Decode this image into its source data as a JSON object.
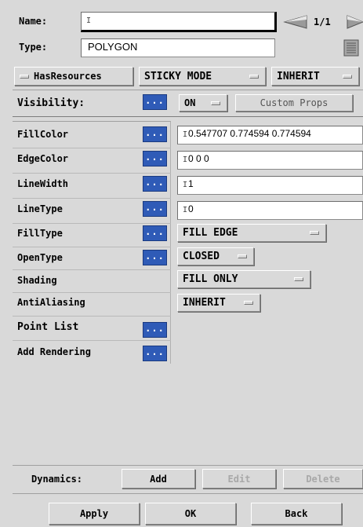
{
  "header": {
    "name_label": "Name:",
    "name_value": "",
    "page_indicator": "1/1",
    "type_label": "Type:",
    "type_value": "POLYGON"
  },
  "options": {
    "has_resources": "HasResources",
    "sticky_mode": "STICKY MODE",
    "inherit": "INHERIT"
  },
  "visibility": {
    "label": "Visibility:",
    "more": "...",
    "value": "ON",
    "custom_props": "Custom Props"
  },
  "properties": [
    {
      "label": "FillColor",
      "more": "...",
      "value": "0.547707 0.774594 0.774594"
    },
    {
      "label": "EdgeColor",
      "more": "...",
      "value": "0 0 0"
    },
    {
      "label": "LineWidth",
      "more": "...",
      "value": "1"
    },
    {
      "label": "LineType",
      "more": "...",
      "value": "0"
    },
    {
      "label": "FillType",
      "more": "...",
      "value": "FILL EDGE"
    },
    {
      "label": "OpenType",
      "more": "...",
      "value": "CLOSED"
    },
    {
      "label": "Shading",
      "value": "FILL ONLY"
    },
    {
      "label": "AntiAliasing",
      "value": "INHERIT"
    },
    {
      "label": "Point List",
      "more": "..."
    },
    {
      "label": "Add Rendering",
      "more": "..."
    }
  ],
  "dynamics": {
    "label": "Dynamics:",
    "add": "Add",
    "edit": "Edit",
    "delete": "Delete"
  },
  "footer": {
    "apply": "Apply",
    "ok": "OK",
    "back": "Back"
  },
  "colors": {
    "background": "#d9d9d9",
    "more_button": "#2f5bb7",
    "field": "#ffffff"
  },
  "icons": {
    "prev": "triangle-left-icon",
    "next": "triangle-right-icon",
    "list": "list-icon"
  }
}
